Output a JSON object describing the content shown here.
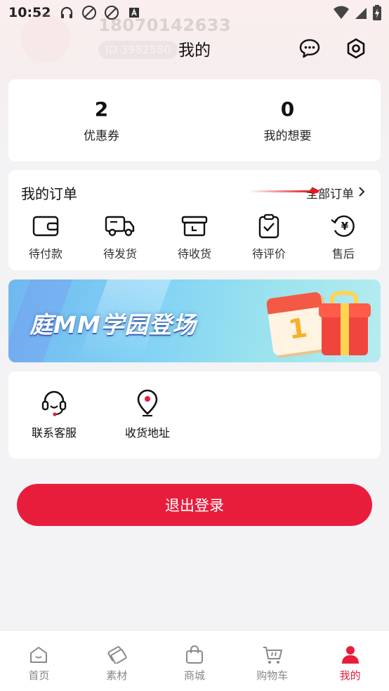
{
  "status_bar": {
    "time": "10:52"
  },
  "profile": {
    "phone": "18070142633",
    "id_text": "ID  3982580"
  },
  "header": {
    "title": "我的"
  },
  "stats": [
    {
      "value": "2",
      "label": "优惠券"
    },
    {
      "value": "0",
      "label": "我的想要"
    }
  ],
  "orders": {
    "title": "我的订单",
    "all_label": "全部订单",
    "items": [
      {
        "label": "待付款",
        "icon": "wallet-icon"
      },
      {
        "label": "待发货",
        "icon": "truck-icon"
      },
      {
        "label": "待收货",
        "icon": "box-icon"
      },
      {
        "label": "待评价",
        "icon": "clipboard-check-icon"
      },
      {
        "label": "售后",
        "icon": "yen-return-icon"
      }
    ]
  },
  "banner": {
    "text": "庭MM学园登场",
    "calendar_number": "1"
  },
  "services": [
    {
      "label": "联系客服",
      "icon": "headset-icon"
    },
    {
      "label": "收货地址",
      "icon": "location-pin-icon"
    }
  ],
  "logout_label": "退出登录",
  "tabs": [
    {
      "label": "首页",
      "icon": "home-icon"
    },
    {
      "label": "素材",
      "icon": "material-icon"
    },
    {
      "label": "商城",
      "icon": "shopping-bag-icon"
    },
    {
      "label": "购物车",
      "icon": "cart-icon"
    },
    {
      "label": "我的",
      "icon": "person-icon"
    }
  ],
  "colors": {
    "accent": "#e81d3c",
    "background": "#f3f3f5"
  }
}
